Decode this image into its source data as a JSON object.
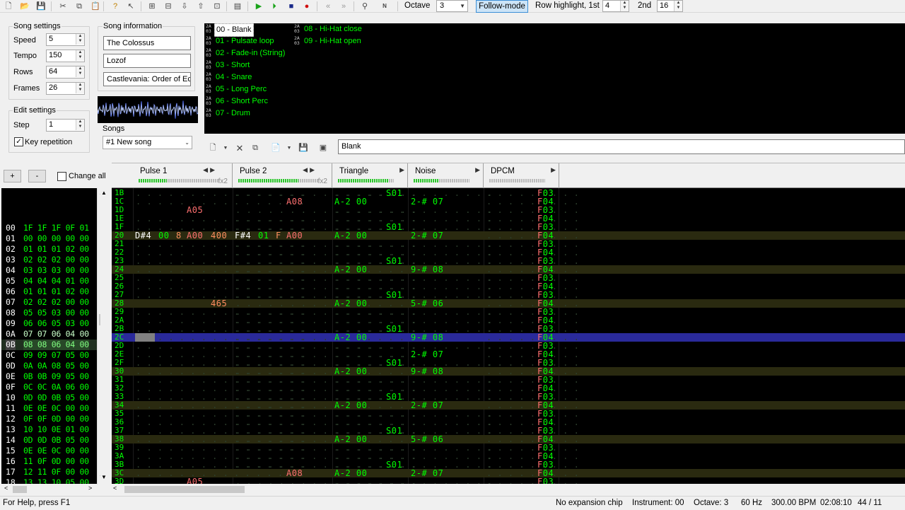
{
  "toolbar": {
    "icons": [
      "new-file-icon",
      "open-folder-icon",
      "save-icon",
      "cut-icon",
      "copy-icon",
      "paste-icon",
      "help-icon",
      "whats-this-icon",
      "insert-frame-icon",
      "remove-frame-icon",
      "move-frame-down-icon",
      "move-frame-up-icon",
      "duplicate-frame-icon",
      "module-properties-icon",
      "play-icon",
      "play-pattern-icon",
      "stop-icon",
      "record-icon",
      "prev-track-icon",
      "next-track-icon",
      "settings-icon",
      "nsf-export-icon"
    ],
    "octave_label": "Octave",
    "octave_value": "3",
    "follow_mode_label": "Follow-mode",
    "row_highlight_label": "Row highlight, 1st",
    "row_highlight_1st": "4",
    "row_highlight_2nd_label": "2nd",
    "row_highlight_2nd": "16"
  },
  "song_settings": {
    "title": "Song settings",
    "speed_label": "Speed",
    "speed": "5",
    "tempo_label": "Tempo",
    "tempo": "150",
    "rows_label": "Rows",
    "rows": "64",
    "frames_label": "Frames",
    "frames": "26"
  },
  "edit_settings": {
    "title": "Edit settings",
    "step_label": "Step",
    "step": "1",
    "key_repetition_label": "Key repetition",
    "key_repetition_checked": true
  },
  "song_information": {
    "title": "Song information",
    "name": "The Colossus",
    "artist": "Lozof",
    "copyright": "Castlevania: Order of Ec"
  },
  "songs": {
    "label": "Songs",
    "selected": "#1 New song"
  },
  "instruments": [
    {
      "chip": "2A\n03",
      "name": "00 - Blank",
      "selected": true
    },
    {
      "chip": "2A\n03",
      "name": "01 - Pulsate loop"
    },
    {
      "chip": "2A\n03",
      "name": "02 - Fade-in (String)"
    },
    {
      "chip": "2A\n03",
      "name": "03 - Short"
    },
    {
      "chip": "2A\n03",
      "name": "04 - Snare"
    },
    {
      "chip": "2A\n03",
      "name": "05 - Long Perc"
    },
    {
      "chip": "2A\n03",
      "name": "06 - Short Perc"
    },
    {
      "chip": "2A\n03",
      "name": "07 - Drum"
    },
    {
      "chip": "2A\n03",
      "name": "08 - Hi-Hat close"
    },
    {
      "chip": "2A\n03",
      "name": "09 - Hi-Hat open"
    }
  ],
  "instrument_name": "Blank",
  "frame_controls": {
    "add_label": "+",
    "remove_label": "-",
    "change_all_label": "Change all"
  },
  "frames": [
    {
      "i": "00",
      "v": "1F 1F 1F 0F 01"
    },
    {
      "i": "01",
      "v": "00 00 00 00 00"
    },
    {
      "i": "02",
      "v": "01 01 01 02 00"
    },
    {
      "i": "03",
      "v": "02 02 02 00 00"
    },
    {
      "i": "04",
      "v": "03 03 03 00 00"
    },
    {
      "i": "05",
      "v": "04 04 04 01 00"
    },
    {
      "i": "06",
      "v": "01 01 01 02 00"
    },
    {
      "i": "07",
      "v": "02 02 02 00 00"
    },
    {
      "i": "08",
      "v": "05 05 03 00 00"
    },
    {
      "i": "09",
      "v": "06 06 05 03 00"
    },
    {
      "i": "0A",
      "v": "07 07 06 04 00"
    },
    {
      "i": "0B",
      "v": "08 08 06 04 00",
      "current": true
    },
    {
      "i": "0C",
      "v": "09 09 07 05 00"
    },
    {
      "i": "0D",
      "v": "0A 0A 08 05 00"
    },
    {
      "i": "0E",
      "v": "0B 0B 09 05 00"
    },
    {
      "i": "0F",
      "v": "0C 0C 0A 06 00"
    },
    {
      "i": "10",
      "v": "0D 0D 0B 05 00"
    },
    {
      "i": "11",
      "v": "0E 0E 0C 00 00"
    },
    {
      "i": "12",
      "v": "0F 0F 0D 00 00"
    },
    {
      "i": "13",
      "v": "10 10 0E 01 00"
    },
    {
      "i": "14",
      "v": "0D 0D 0B 05 00"
    },
    {
      "i": "15",
      "v": "0E 0E 0C 00 00"
    },
    {
      "i": "16",
      "v": "11 0F 0D 00 00"
    },
    {
      "i": "17",
      "v": "12 11 0F 00 00"
    },
    {
      "i": "18",
      "v": "13 13 10 05 00"
    }
  ],
  "channels": [
    {
      "name": "Pulse 1",
      "fx": "fx2",
      "level": 0.35,
      "arrows": "lr"
    },
    {
      "name": "Pulse 2",
      "fx": "fx2",
      "level": 0.75,
      "arrows": "lr"
    },
    {
      "name": "Triangle",
      "fx": "",
      "level": 0.9,
      "arrows": "r"
    },
    {
      "name": "Noise",
      "fx": "",
      "level": 0.45,
      "arrows": "r"
    },
    {
      "name": "DPCM",
      "fx": "",
      "level": 0,
      "arrows": "r"
    }
  ],
  "pattern_rows": [
    {
      "n": "1B",
      "p1": "",
      "p2": "",
      "tri": "",
      "tri_fx": "S01",
      "noi": "",
      "dpcm": "F03"
    },
    {
      "n": "1C",
      "p1": "",
      "p2": "A08",
      "tri": "A-2 00",
      "tri_fx": "",
      "noi": "2-# 07",
      "dpcm": "F04"
    },
    {
      "n": "1D",
      "p1": "A05",
      "p2": "",
      "tri": "",
      "tri_fx": "",
      "noi": "",
      "dpcm": "F03"
    },
    {
      "n": "1E",
      "p1": "",
      "p2": "",
      "tri": "",
      "tri_fx": "",
      "noi": "",
      "dpcm": "F04"
    },
    {
      "n": "1F",
      "p1": "",
      "p2": "",
      "tri": "",
      "tri_fx": "S01",
      "noi": "",
      "dpcm": "F03"
    },
    {
      "n": "20",
      "p1": "D#4 00 8 A00 400",
      "p2": "F#4 01 F A00",
      "tri": "A-2 00",
      "tri_fx": "",
      "noi": "2-# 07",
      "dpcm": "F04",
      "hl": true
    },
    {
      "n": "21",
      "p1": "",
      "p2": "",
      "tri": "",
      "tri_fx": "",
      "noi": "",
      "dpcm": "F03"
    },
    {
      "n": "22",
      "p1": "",
      "p2": "",
      "tri": "",
      "tri_fx": "",
      "noi": "",
      "dpcm": "F04"
    },
    {
      "n": "23",
      "p1": "",
      "p2": "",
      "tri": "",
      "tri_fx": "S01",
      "noi": "",
      "dpcm": "F03"
    },
    {
      "n": "24",
      "p1": "",
      "p2": "",
      "tri": "A-2 00",
      "tri_fx": "",
      "noi": "9-# 08",
      "dpcm": "F04",
      "hl": true
    },
    {
      "n": "25",
      "p1": "",
      "p2": "",
      "tri": "",
      "tri_fx": "",
      "noi": "",
      "dpcm": "F03"
    },
    {
      "n": "26",
      "p1": "",
      "p2": "",
      "tri": "",
      "tri_fx": "",
      "noi": "",
      "dpcm": "F04"
    },
    {
      "n": "27",
      "p1": "",
      "p2": "",
      "tri": "",
      "tri_fx": "S01",
      "noi": "",
      "dpcm": "F03"
    },
    {
      "n": "28",
      "p1": "465",
      "p2": "",
      "tri": "A-2 00",
      "tri_fx": "",
      "noi": "5-# 06",
      "dpcm": "F04",
      "hl": true
    },
    {
      "n": "29",
      "p1": "",
      "p2": "",
      "tri": "",
      "tri_fx": "",
      "noi": "",
      "dpcm": "F03"
    },
    {
      "n": "2A",
      "p1": "",
      "p2": "",
      "tri": "",
      "tri_fx": "",
      "noi": "",
      "dpcm": "F04"
    },
    {
      "n": "2B",
      "p1": "",
      "p2": "",
      "tri": "",
      "tri_fx": "S01",
      "noi": "",
      "dpcm": "F03"
    },
    {
      "n": "2C",
      "p1": "",
      "p2": "",
      "tri": "A-2 00",
      "tri_fx": "",
      "noi": "9-# 08",
      "dpcm": "F04",
      "cur": true
    },
    {
      "n": "2D",
      "p1": "",
      "p2": "",
      "tri": "",
      "tri_fx": "",
      "noi": "",
      "dpcm": "F03"
    },
    {
      "n": "2E",
      "p1": "",
      "p2": "",
      "tri": "",
      "tri_fx": "",
      "noi": "2-# 07",
      "dpcm": "F04"
    },
    {
      "n": "2F",
      "p1": "",
      "p2": "",
      "tri": "",
      "tri_fx": "S01",
      "noi": "",
      "dpcm": "F03"
    },
    {
      "n": "30",
      "p1": "",
      "p2": "",
      "tri": "A-2 00",
      "tri_fx": "",
      "noi": "9-# 08",
      "dpcm": "F04",
      "hl": true
    },
    {
      "n": "31",
      "p1": "",
      "p2": "",
      "tri": "",
      "tri_fx": "",
      "noi": "",
      "dpcm": "F03"
    },
    {
      "n": "32",
      "p1": "",
      "p2": "",
      "tri": "",
      "tri_fx": "",
      "noi": "",
      "dpcm": "F04"
    },
    {
      "n": "33",
      "p1": "",
      "p2": "",
      "tri": "",
      "tri_fx": "S01",
      "noi": "",
      "dpcm": "F03"
    },
    {
      "n": "34",
      "p1": "",
      "p2": "",
      "tri": "A-2 00",
      "tri_fx": "",
      "noi": "2-# 07",
      "dpcm": "F04",
      "hl": true
    },
    {
      "n": "35",
      "p1": "",
      "p2": "",
      "tri": "",
      "tri_fx": "",
      "noi": "",
      "dpcm": "F03"
    },
    {
      "n": "36",
      "p1": "",
      "p2": "",
      "tri": "",
      "tri_fx": "",
      "noi": "",
      "dpcm": "F04"
    },
    {
      "n": "37",
      "p1": "",
      "p2": "",
      "tri": "",
      "tri_fx": "S01",
      "noi": "",
      "dpcm": "F03"
    },
    {
      "n": "38",
      "p1": "",
      "p2": "",
      "tri": "A-2 00",
      "tri_fx": "",
      "noi": "5-# 06",
      "dpcm": "F04",
      "hl": true
    },
    {
      "n": "39",
      "p1": "",
      "p2": "",
      "tri": "",
      "tri_fx": "",
      "noi": "",
      "dpcm": "F03"
    },
    {
      "n": "3A",
      "p1": "",
      "p2": "",
      "tri": "",
      "tri_fx": "",
      "noi": "",
      "dpcm": "F04"
    },
    {
      "n": "3B",
      "p1": "",
      "p2": "",
      "tri": "",
      "tri_fx": "S01",
      "noi": "",
      "dpcm": "F03"
    },
    {
      "n": "3C",
      "p1": "",
      "p2": "A08",
      "tri": "A-2 00",
      "tri_fx": "",
      "noi": "2-# 07",
      "dpcm": "F04",
      "hl": true
    },
    {
      "n": "3D",
      "p1": "A05",
      "p2": "",
      "tri": "",
      "tri_fx": "",
      "noi": "",
      "dpcm": "F03"
    }
  ],
  "status": {
    "help": "For Help, press F1",
    "chip": "No expansion chip",
    "instrument": "Instrument: 00",
    "octave": "Octave: 3",
    "rate": "60 Hz",
    "bpm": "300.00 BPM",
    "time": "02:08:10",
    "position": "44 / 11"
  },
  "colors": {
    "pattern_bg": "#000000",
    "note_green": "#00ff00",
    "effect_red": "#ff6060",
    "effect_orange": "#e08040",
    "cursor_row": "#2a2a9a",
    "highlight_row": "#2a2a10"
  }
}
